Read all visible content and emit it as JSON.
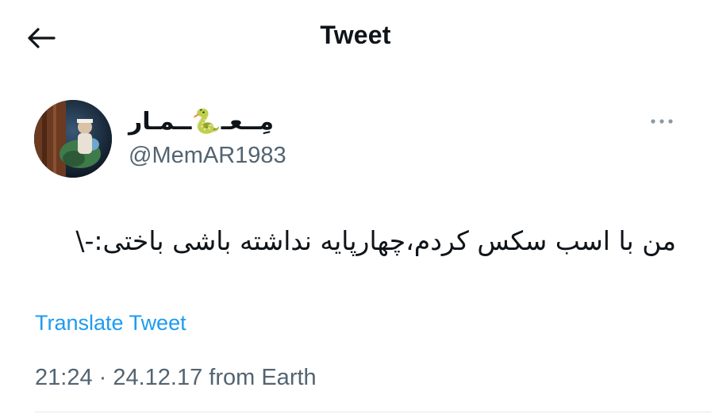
{
  "header": {
    "title": "Tweet",
    "back_icon": "arrow-left-icon"
  },
  "author": {
    "display_name": "مِــعـ🐍ــمـار",
    "handle": "@MemAR1983",
    "avatar_icon": "avatar-image"
  },
  "more_icon": "ellipsis-icon",
  "tweet": {
    "text": "من با اسب سکس کردم،چهارپایه نداشته باشی باختی:-\\"
  },
  "translate_label": "Translate Tweet",
  "meta": {
    "timestamp": "21:24 · 24.12.17 from Earth"
  },
  "colors": {
    "link": "#1d9bf0",
    "muted": "#536471",
    "text": "#0f1419"
  }
}
